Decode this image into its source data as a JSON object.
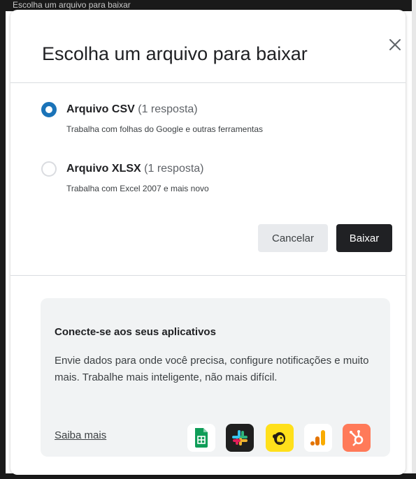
{
  "background": {
    "top_strip_text": "Escolha um arquivo para baixar"
  },
  "dialog": {
    "title": "Escolha um arquivo para baixar",
    "close_icon": "close-icon",
    "options": [
      {
        "name": "Arquivo CSV",
        "count": "(1 resposta)",
        "description": "Trabalha com folhas do Google e outras ferramentas",
        "selected": true
      },
      {
        "name": "Arquivo XLSX",
        "count": "(1 resposta)",
        "description": "Trabalha com Excel 2007 e mais novo",
        "selected": false
      }
    ],
    "buttons": {
      "cancel_label": "Cancelar",
      "download_label": "Baixar"
    },
    "card": {
      "title": "Conecte-se aos seus aplicativos",
      "text": "Envie dados para onde você precisa, configure notificações e muito mais. Trabalhe mais inteligente, não mais difícil.",
      "link_label": "Saiba mais",
      "apps": [
        "google-sheets-icon",
        "slack-icon",
        "mailchimp-icon",
        "google-analytics-icon",
        "hubspot-icon"
      ]
    }
  },
  "colors": {
    "accent": "#1a73b8",
    "primary_button": "#202124",
    "card_background": "#f1f3f4"
  }
}
